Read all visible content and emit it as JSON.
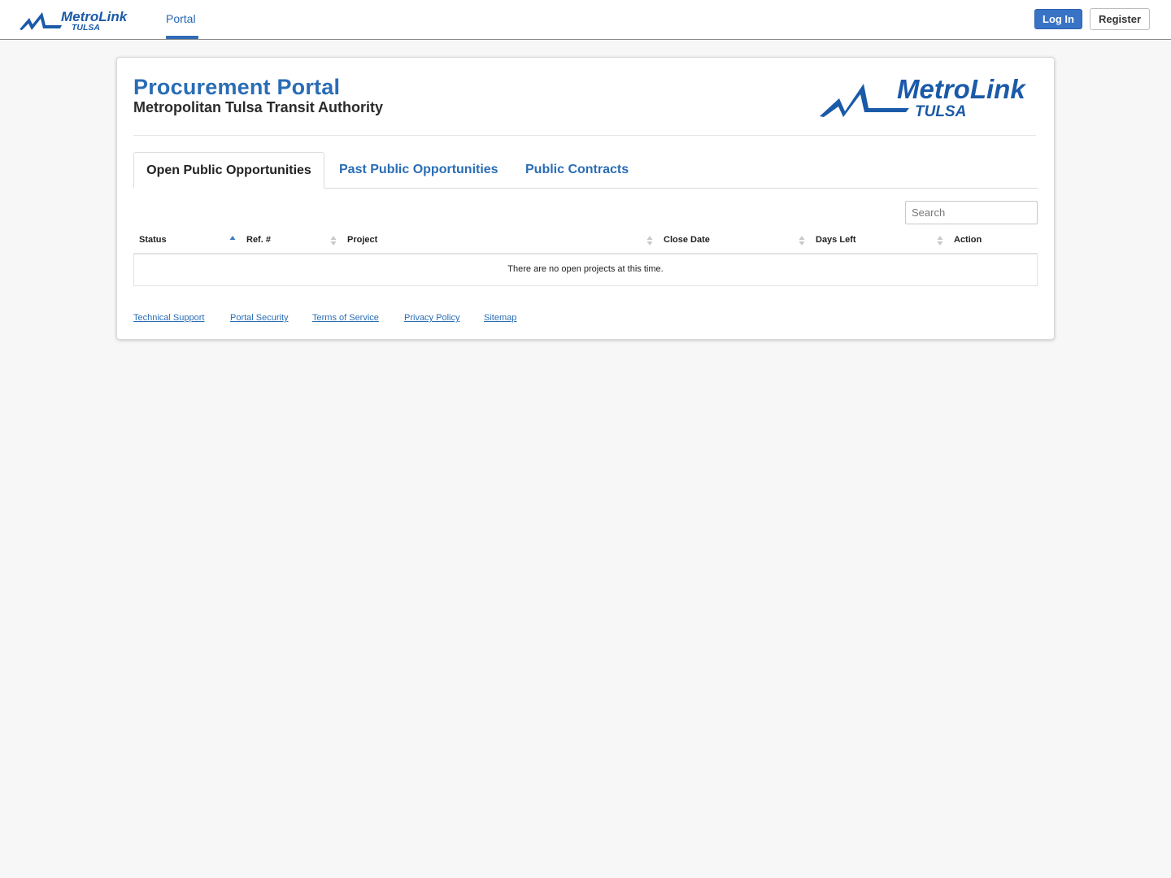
{
  "nav": {
    "portal_label": "Portal",
    "login_label": "Log In",
    "register_label": "Register"
  },
  "brand": {
    "name_top": "MetroLink",
    "name_bottom": "TULSA",
    "color": "#1a5aa8",
    "accent": "#2a6db5"
  },
  "header": {
    "title": "Procurement Portal",
    "subtitle": "Metropolitan Tulsa Transit Authority"
  },
  "tabs": [
    {
      "label": "Open Public Opportunities",
      "active": true
    },
    {
      "label": "Past Public Opportunities",
      "active": false
    },
    {
      "label": "Public Contracts",
      "active": false
    }
  ],
  "search": {
    "placeholder": "Search"
  },
  "table": {
    "columns": [
      "Status",
      "Ref. #",
      "Project",
      "Close Date",
      "Days Left",
      "Action"
    ],
    "sorted_column": "Status",
    "sort_direction": "ascending",
    "empty_message": "There are no open projects at this time."
  },
  "footer": {
    "links": [
      "Technical Support",
      "Portal Security",
      "Terms of Service",
      "Privacy Policy",
      "Sitemap"
    ]
  }
}
